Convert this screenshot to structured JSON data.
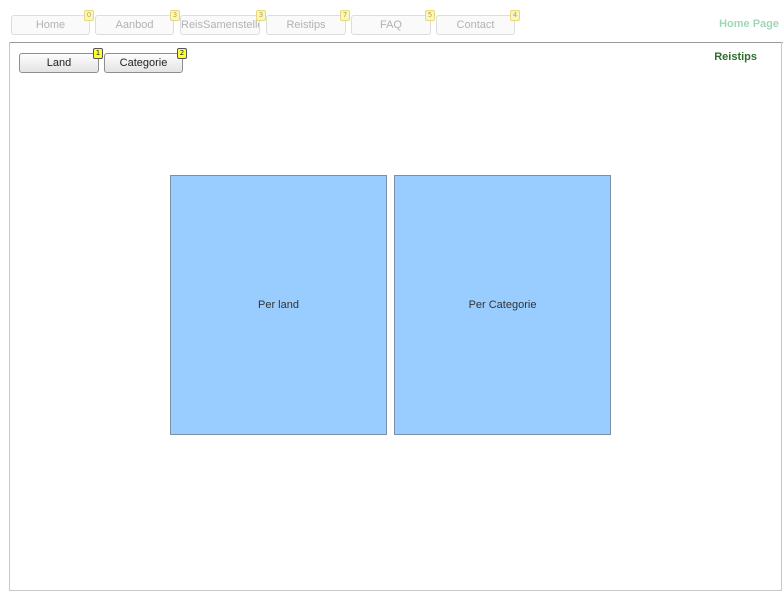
{
  "nav": {
    "items": [
      {
        "label": "Home",
        "badge": "0"
      },
      {
        "label": "Aanbod",
        "badge": "3"
      },
      {
        "label": "ReisSamenstelle",
        "badge": "3"
      },
      {
        "label": "Reistips",
        "badge": "7"
      },
      {
        "label": "FAQ",
        "badge": "5"
      },
      {
        "label": "Contact",
        "badge": "4"
      }
    ],
    "page_link": "Home Page"
  },
  "page": {
    "title": "Reistips"
  },
  "subnav": {
    "items": [
      {
        "label": "Land",
        "badge": "1"
      },
      {
        "label": "Categorie",
        "badge": "2"
      }
    ]
  },
  "tiles": [
    {
      "label": "Per land"
    },
    {
      "label": "Per Categorie"
    }
  ],
  "colors": {
    "tile_fill": "#99ccff",
    "badge_yellow": "#ffff33",
    "page_title_green": "#2e6e2e",
    "home_page_green": "#9fd7b7"
  }
}
